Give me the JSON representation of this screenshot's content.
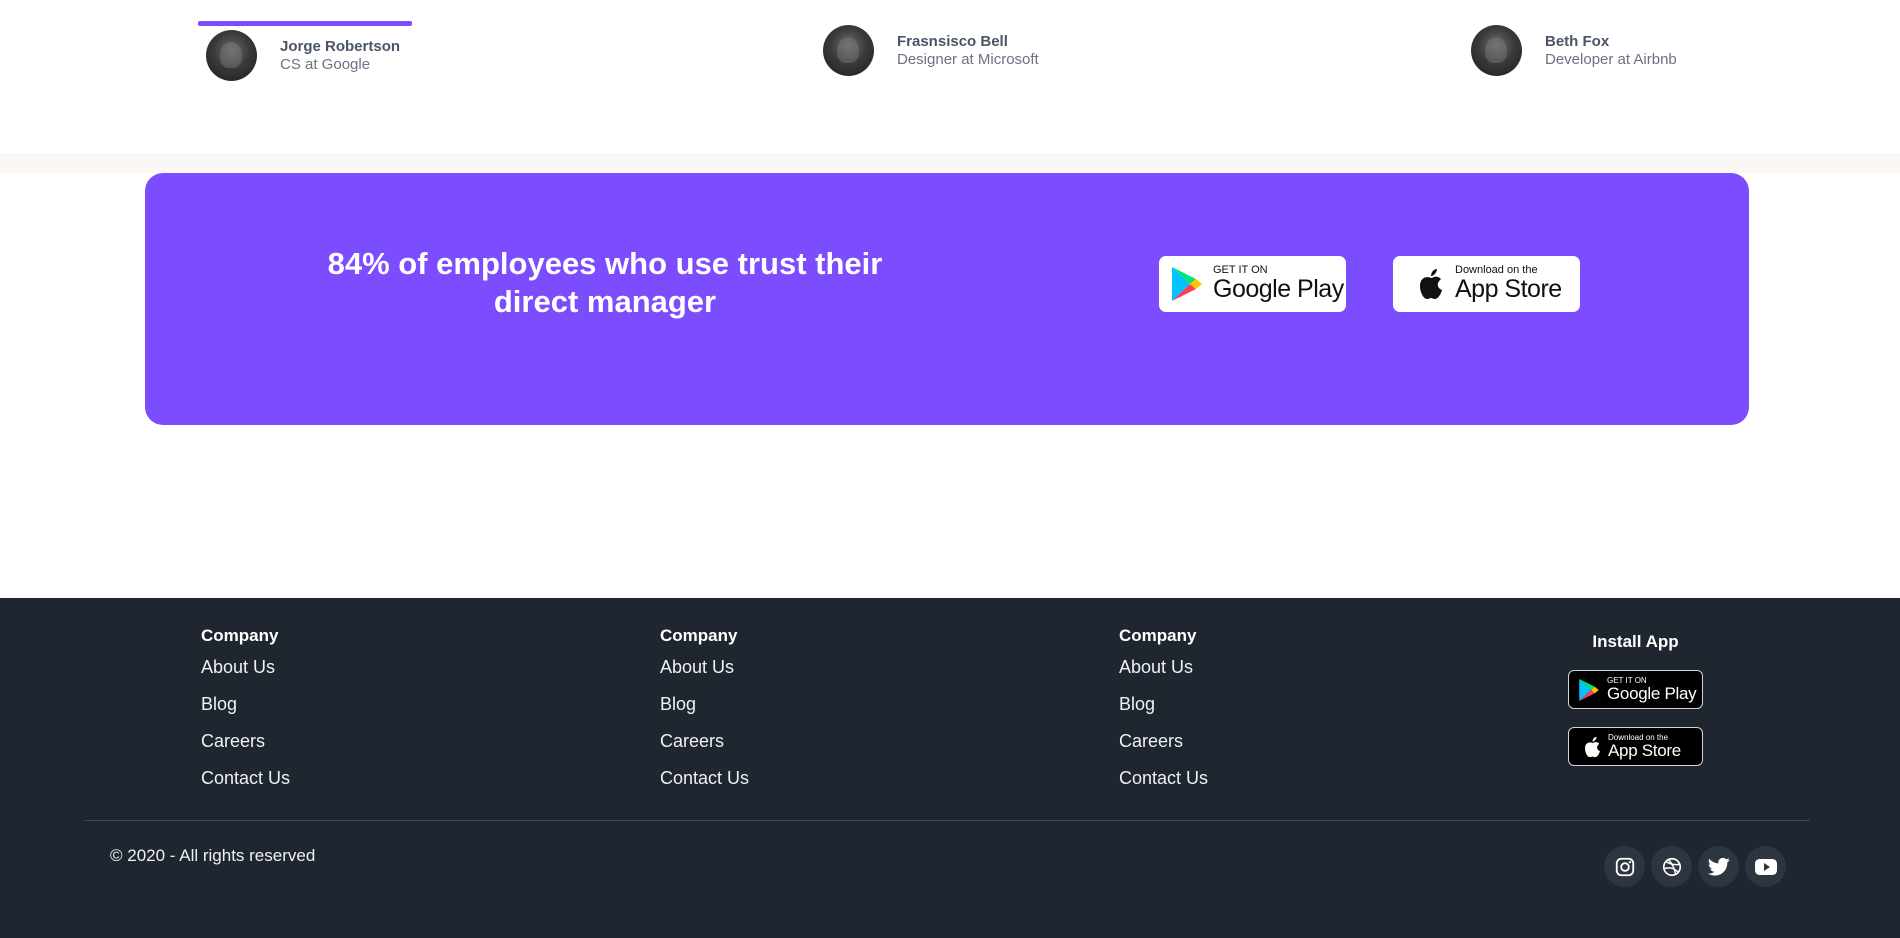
{
  "testimonials": {
    "people": [
      {
        "name": "Jorge Robertson",
        "role": "CS at Google",
        "active": true
      },
      {
        "name": "Frasnsisco Bell",
        "role": "Designer at Microsoft",
        "active": false
      },
      {
        "name": "Beth Fox",
        "role": "Developer at Airbnb",
        "active": false
      }
    ]
  },
  "cta": {
    "title": "84% of employees who use trust their direct manager",
    "google_play": {
      "small": "GET IT ON",
      "big": "Google Play"
    },
    "app_store": {
      "small": "Download on the",
      "big": "App Store"
    }
  },
  "footer": {
    "columns": [
      {
        "heading": "Company",
        "links": [
          "About Us",
          "Blog",
          "Careers",
          "Contact Us"
        ]
      },
      {
        "heading": "Company",
        "links": [
          "About Us",
          "Blog",
          "Careers",
          "Contact Us"
        ]
      },
      {
        "heading": "Company",
        "links": [
          "About Us",
          "Blog",
          "Careers",
          "Contact Us"
        ]
      }
    ],
    "install": {
      "heading": "Install App",
      "google_play": {
        "small": "GET IT ON",
        "big": "Google Play"
      },
      "app_store": {
        "small": "Download on the",
        "big": "App Store"
      }
    },
    "copyright": "© 2020 - All rights reserved",
    "socials": [
      "instagram-icon",
      "dribbble-icon",
      "twitter-icon",
      "youtube-icon"
    ]
  },
  "colors": {
    "accent": "#7b4dff",
    "footer_bg": "#1f2630"
  }
}
